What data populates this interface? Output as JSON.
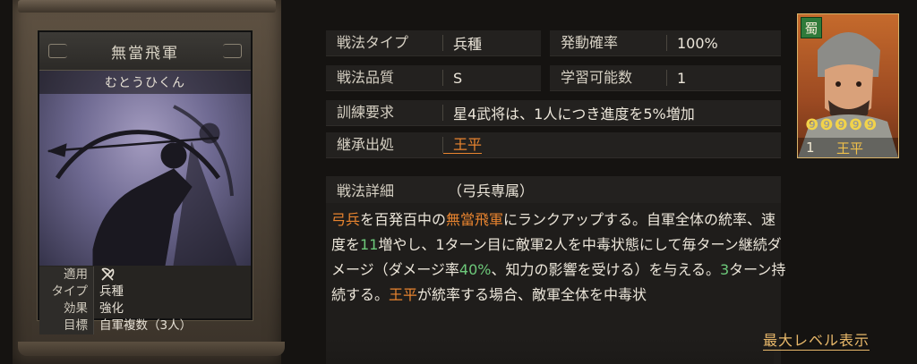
{
  "card": {
    "title": "無當飛軍",
    "reading": "むとうひくん",
    "attributes": [
      {
        "key": "適用",
        "value": "",
        "icon": "crossed-bows-icon"
      },
      {
        "key": "タイプ",
        "value": "兵種"
      },
      {
        "key": "効果",
        "value": "強化"
      },
      {
        "key": "目標",
        "value": "自軍複数（3人）"
      }
    ]
  },
  "info": {
    "type_label": "戦法タイプ",
    "type_value": "兵種",
    "rate_label": "発動確率",
    "rate_value": "100%",
    "quality_label": "戦法品質",
    "quality_value": "S",
    "learn_label": "学習可能数",
    "learn_value": "1",
    "training_label": "訓練要求",
    "training_value": "星4武将は、1人につき進度を5%増加",
    "inherit_label": "継承出処",
    "inherit_value": "王平"
  },
  "detail": {
    "label": "戦法詳細",
    "note": "（弓兵専属）",
    "text": [
      {
        "t": "弓兵",
        "c": "o"
      },
      {
        "t": "を百発百中の"
      },
      {
        "t": "無當飛軍",
        "c": "o"
      },
      {
        "t": "にランクアップする。自軍全体の統率、速度を"
      },
      {
        "t": "11",
        "c": "g"
      },
      {
        "t": "増やし、1ターン目に敵軍2人を中毒状態にして毎ターン継続ダメージ（ダメージ率"
      },
      {
        "t": "40%",
        "c": "g"
      },
      {
        "t": "、知力の影響を受ける）を与える。"
      },
      {
        "t": "3",
        "c": "g"
      },
      {
        "t": "ターン持続する。"
      },
      {
        "t": "王平",
        "c": "o"
      },
      {
        "t": "が統率する場合、敵軍全体を中毒状"
      }
    ],
    "max_level_label": "最大レベル表示"
  },
  "portrait": {
    "kingdom": "蜀",
    "stars": "❾❾❾❾❾",
    "cost": "1",
    "name": "王平"
  },
  "colors": {
    "accent": "#e8842f",
    "number": "#6dc97a",
    "kingdom": "#2f7a3a"
  }
}
